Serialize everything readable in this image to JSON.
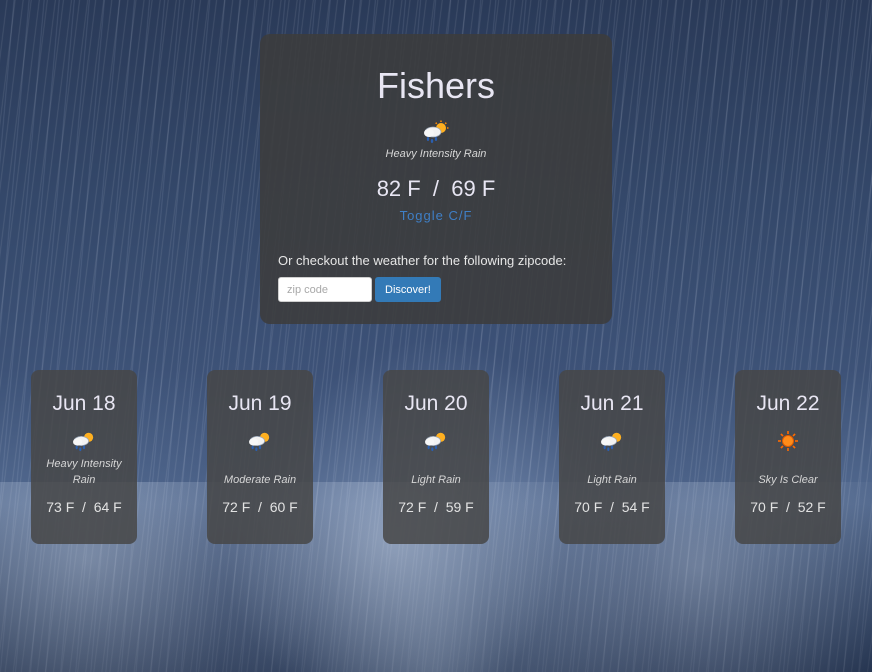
{
  "current": {
    "city": "Fishers",
    "icon": "rain-sun-icon",
    "description": "Heavy Intensity Rain",
    "temp": "82 F  /  69 F",
    "toggle_label": "Toggle C/F"
  },
  "zip": {
    "label": "Or checkout the weather for the following zipcode:",
    "placeholder": "zip code",
    "value": "",
    "button_label": "Discover!"
  },
  "forecast": [
    {
      "date": "Jun 18",
      "icon": "rain-sun-icon",
      "description": "Heavy Intensity Rain",
      "temp": "73 F  /  64 F"
    },
    {
      "date": "Jun 19",
      "icon": "rain-sun-icon",
      "description": "Moderate Rain",
      "temp": "72 F  /  60 F"
    },
    {
      "date": "Jun 20",
      "icon": "rain-sun-icon",
      "description": "Light Rain",
      "temp": "72 F  /  59 F"
    },
    {
      "date": "Jun 21",
      "icon": "rain-sun-icon",
      "description": "Light Rain",
      "temp": "70 F  /  54 F"
    },
    {
      "date": "Jun 22",
      "icon": "sun-icon",
      "description": "Sky Is Clear",
      "temp": "70 F  /  52 F"
    }
  ],
  "colors": {
    "accent": "#337ab7",
    "toggle": "#3f7fc6",
    "card_bg": "#3c3c3c"
  }
}
